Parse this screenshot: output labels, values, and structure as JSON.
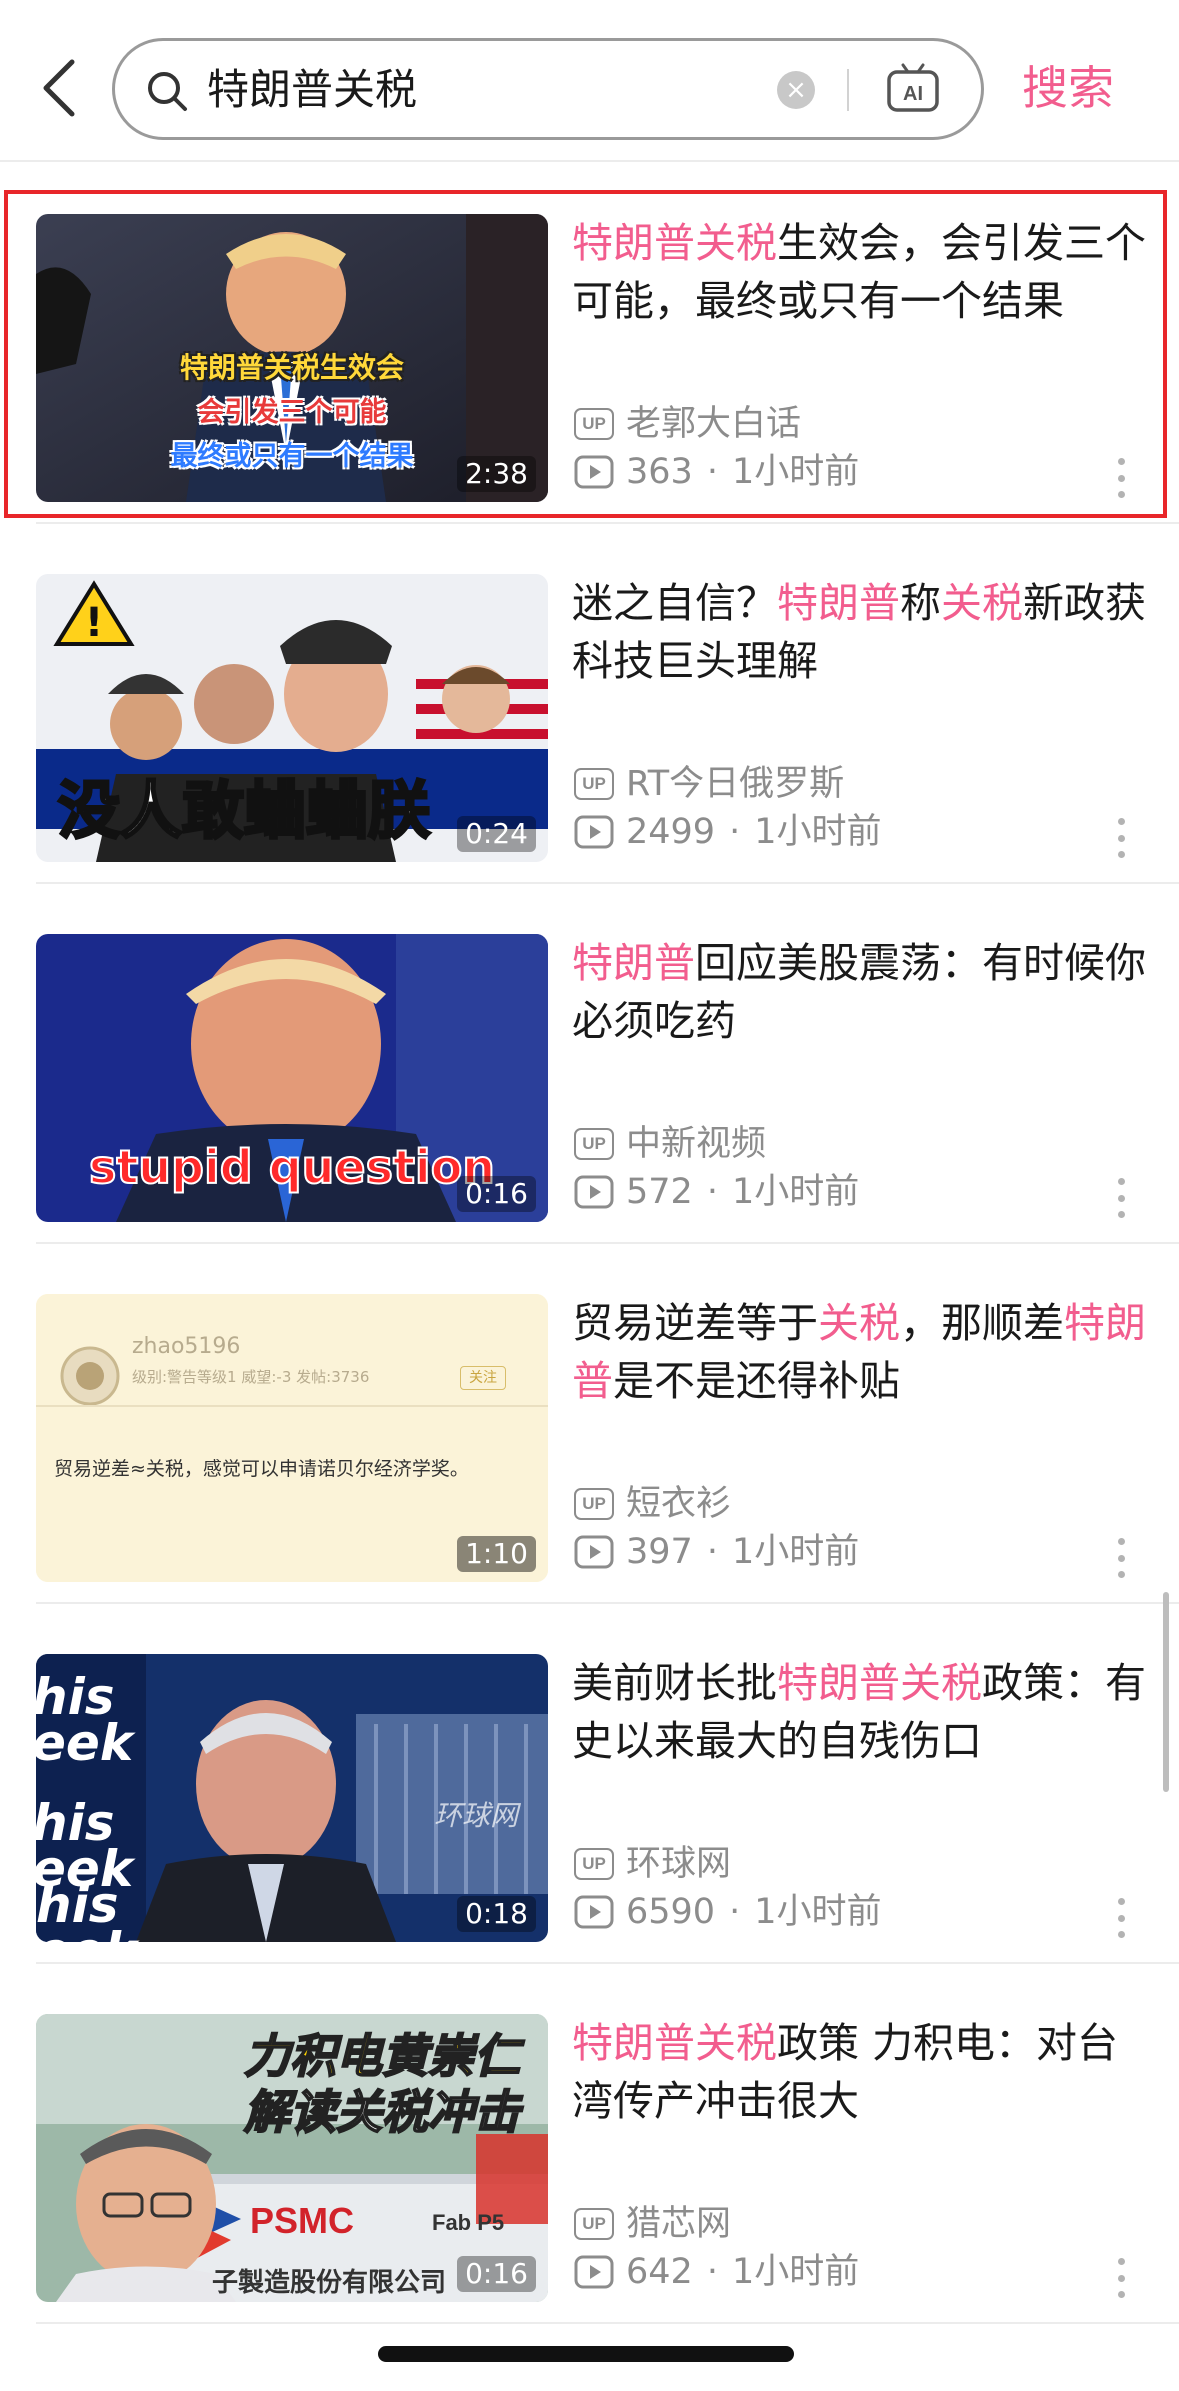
{
  "search": {
    "query": "特朗普关税",
    "submit_label": "搜索",
    "ai_label": "AI"
  },
  "results": [
    {
      "title_parts": [
        {
          "text": "特朗普关税",
          "hl": true
        },
        {
          "text": "生效会，会引发三个可能，最终或只有一个结果",
          "hl": false
        }
      ],
      "uploader": "老郭大白话",
      "views": "363",
      "time": "1小时前",
      "duration": "2:38",
      "thumb_captions": [
        "特朗普关税生效会",
        "会引发三个可能",
        "最终或只有一个结果"
      ],
      "highlighted": true
    },
    {
      "title_parts": [
        {
          "text": "迷之自信？",
          "hl": false
        },
        {
          "text": "特朗普",
          "hl": true
        },
        {
          "text": "称",
          "hl": false
        },
        {
          "text": "关税",
          "hl": true
        },
        {
          "text": "新政获科技巨头理解",
          "hl": false
        }
      ],
      "uploader": "RT今日俄罗斯",
      "views": "2499",
      "time": "1小时前",
      "duration": "0:24",
      "thumb_captions": [
        "没人敢蛐蛐朕"
      ]
    },
    {
      "title_parts": [
        {
          "text": "特朗普",
          "hl": true
        },
        {
          "text": "回应美股震荡：有时候你必须吃药",
          "hl": false
        }
      ],
      "uploader": "中新视频",
      "views": "572",
      "time": "1小时前",
      "duration": "0:16",
      "thumb_captions": [
        "stupid question"
      ]
    },
    {
      "title_parts": [
        {
          "text": "贸易逆差等于",
          "hl": false
        },
        {
          "text": "关税",
          "hl": true
        },
        {
          "text": "，那顺差",
          "hl": false
        },
        {
          "text": "特朗普",
          "hl": true
        },
        {
          "text": "是不是还得补贴",
          "hl": false
        }
      ],
      "uploader": "短衣衫",
      "views": "397",
      "time": "1小时前",
      "duration": "1:10",
      "thumb_captions": [
        "zhao5196",
        "级别:警告等级1 威望:-3 发帖:3736",
        "关注",
        "贸易逆差≈关税，感觉可以申请诺贝尔经济学奖。"
      ]
    },
    {
      "title_parts": [
        {
          "text": "美前财长批",
          "hl": false
        },
        {
          "text": "特朗普关税",
          "hl": true
        },
        {
          "text": "政策：有史以来最大的自残伤口",
          "hl": false
        }
      ],
      "uploader": "环球网",
      "views": "6590",
      "time": "1小时前",
      "duration": "0:18",
      "thumb_captions": [
        "his",
        "eek",
        "his",
        "eek",
        "his",
        "eek",
        "环球网"
      ]
    },
    {
      "title_parts": [
        {
          "text": "特朗普关税",
          "hl": true
        },
        {
          "text": "政策 力积电：对台湾传产冲击很大",
          "hl": false
        }
      ],
      "uploader": "猎芯网",
      "views": "642",
      "time": "1小时前",
      "duration": "0:16",
      "thumb_captions": [
        "力积电黄崇仁",
        "解读关税冲击",
        "PSMC",
        "Fab P5",
        "子製造股份有限公司"
      ]
    }
  ],
  "colors": {
    "accent": "#f25d8e",
    "highlight_border": "#e8262a",
    "meta": "#8c8c8c"
  }
}
